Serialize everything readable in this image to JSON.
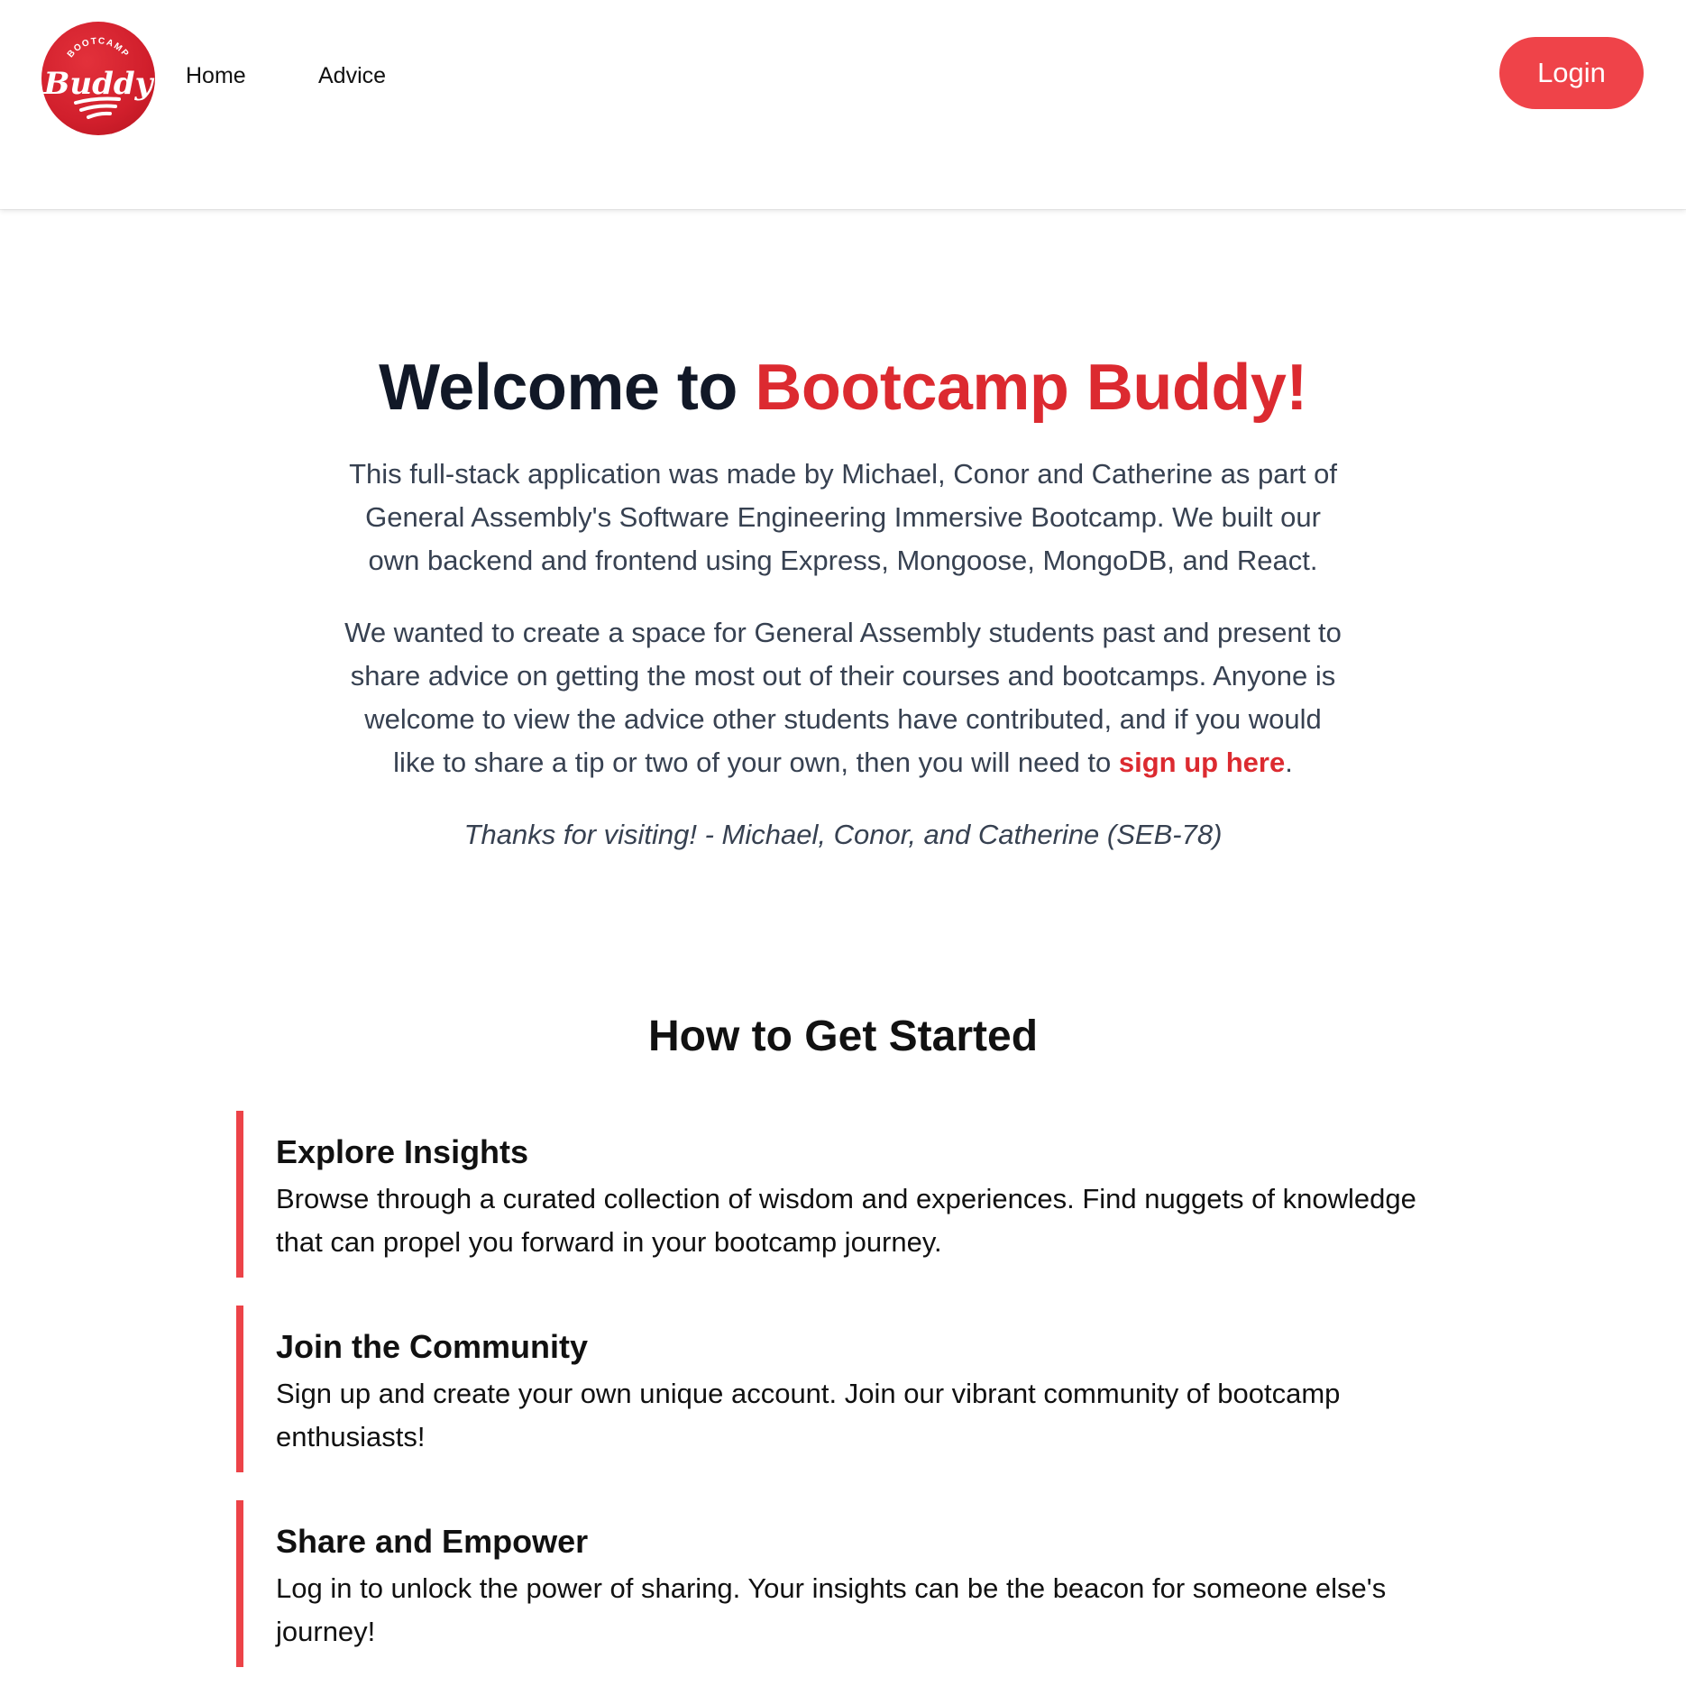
{
  "nav": {
    "logo_label": "BOOTCAMP Buddy",
    "links": [
      {
        "label": "Home"
      },
      {
        "label": "Advice"
      }
    ],
    "login_label": "Login"
  },
  "hero": {
    "title_prefix": "Welcome to ",
    "title_accent": "Bootcamp Buddy!",
    "para1": "This full-stack application was made by Michael, Conor and Catherine as part of General Assembly's Software Engineering Immersive Bootcamp. We built our own backend and frontend using Express, Mongoose, MongoDB, and React.",
    "para2_before": "We wanted to create a space for General Assembly students past and present to share advice on getting the most out of their courses and bootcamps. Anyone is welcome to view the advice other students have contributed, and if you would like to share a tip or two of your own, then you will need to ",
    "para2_link": "sign up here",
    "para2_after": ".",
    "signoff": "Thanks for visiting! - Michael, Conor, and Catherine (SEB-78)"
  },
  "steps": {
    "title": "How to Get Started",
    "items": [
      {
        "heading": "Explore Insights",
        "text": "Browse through a curated collection of wisdom and experiences. Find nuggets of knowledge that can propel you forward in your bootcamp journey."
      },
      {
        "heading": "Join the Community",
        "text": "Sign up and create your own unique account. Join our vibrant community of bootcamp enthusiasts!"
      },
      {
        "heading": "Share and Empower",
        "text": "Log in to unlock the power of sharing. Your insights can be the beacon for someone else's journey!"
      }
    ]
  },
  "colors": {
    "brand_red": "#dc2a30",
    "button_red": "#ef4349",
    "accent_border": "#ec4348"
  }
}
